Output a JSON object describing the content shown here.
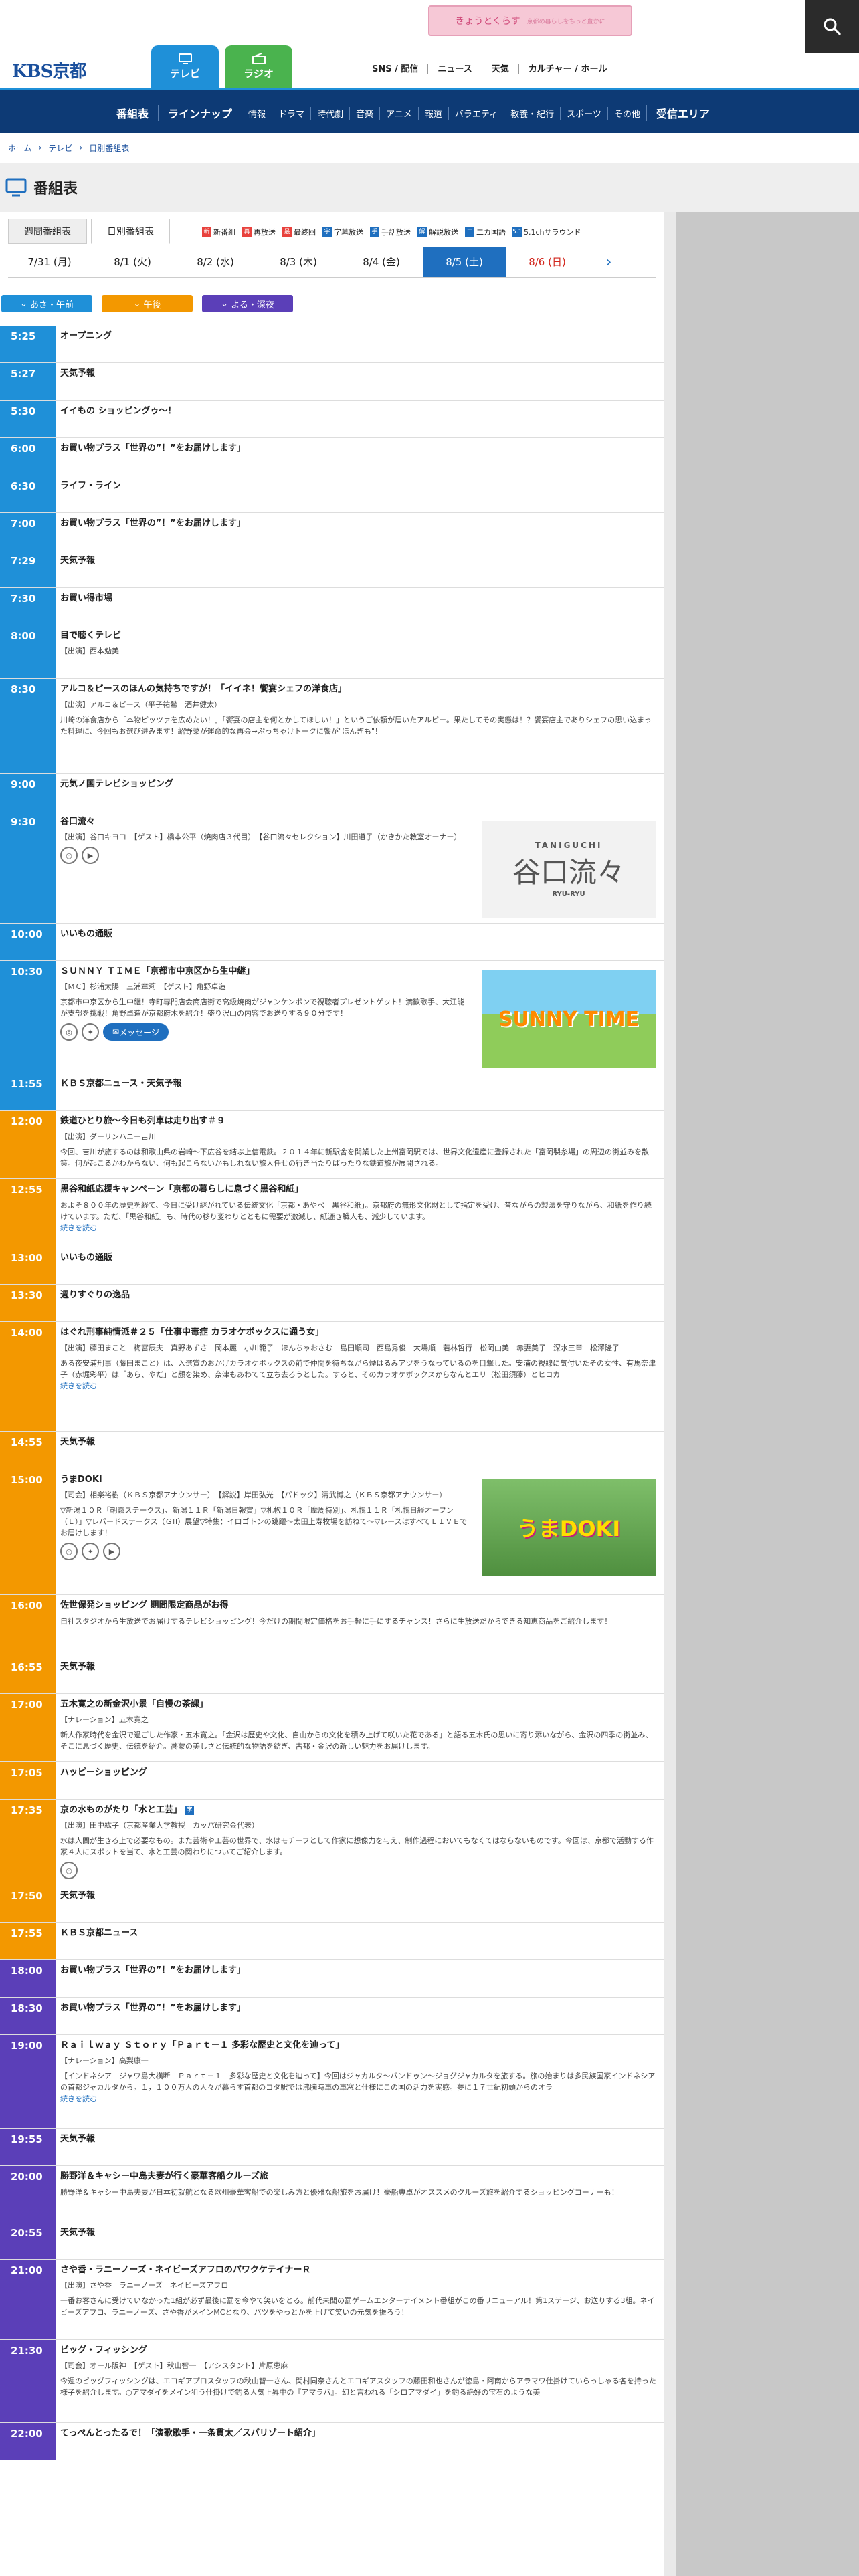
{
  "banner": {
    "text": "きょうとくらす",
    "sub": "京都の暮らしをもっと豊かに"
  },
  "logo": "KBS京都",
  "tabs": {
    "tv": "テレビ",
    "radio": "ラジオ"
  },
  "topnav": [
    "SNS / 配信",
    "ニュース",
    "天気",
    "カルチャー / ホール"
  ],
  "catbar": {
    "left": [
      "番組表",
      "ラインナップ"
    ],
    "items": [
      "情報",
      "ドラマ",
      "時代劇",
      "音楽",
      "アニメ",
      "報道",
      "バラエティ",
      "教養・紀行",
      "スポーツ",
      "その他"
    ],
    "right": "受信エリア"
  },
  "breadcrumb": [
    "ホーム",
    "テレビ",
    "日別番組表"
  ],
  "page_title": "番組表",
  "subtabs": [
    "週間番組表",
    "日別番組表"
  ],
  "legend": [
    {
      "mark": "新",
      "label": "新番組",
      "color": "#e8423d"
    },
    {
      "mark": "再",
      "label": "再放送",
      "color": "#e8423d"
    },
    {
      "mark": "最",
      "label": "最終回",
      "color": "#e8423d"
    },
    {
      "mark": "字",
      "label": "字幕放送",
      "color": "#1f6fbf"
    },
    {
      "mark": "手",
      "label": "手話放送",
      "color": "#1f6fbf"
    },
    {
      "mark": "解",
      "label": "解説放送",
      "color": "#1f6fbf"
    },
    {
      "mark": "二",
      "label": "二カ国語",
      "color": "#1f6fbf"
    },
    {
      "mark": "5.1",
      "label": "5.1chサラウンド",
      "color": "#1f6fbf"
    }
  ],
  "dates": [
    "7/31 (月)",
    "8/1 (火)",
    "8/2 (水)",
    "8/3 (木)",
    "8/4 (金)",
    "8/5 (土)",
    "8/6 (日)"
  ],
  "periods": [
    "あさ・午前",
    "午後",
    "よる・深夜"
  ],
  "more": "続きを読む",
  "message_btn": "メッセージ",
  "colors": {
    "morning": "#1f90d8",
    "afternoon": "#f39800",
    "night": "#5b3fb8"
  },
  "programs": [
    {
      "time": "5:25",
      "title": "オープニング",
      "band": "morning",
      "h": 56
    },
    {
      "time": "5:27",
      "title": "天気予報",
      "band": "morning",
      "h": 56
    },
    {
      "time": "5:30",
      "title": "イイもの ショッピングゥ〜！",
      "band": "morning",
      "h": 56
    },
    {
      "time": "6:00",
      "title": "お買い物プラス「世界の”！”をお届けします」",
      "band": "morning",
      "h": 56
    },
    {
      "time": "6:30",
      "title": "ライフ・ライン",
      "band": "morning",
      "h": 56
    },
    {
      "time": "7:00",
      "title": "お買い物プラス「世界の”！”をお届けします」",
      "band": "morning",
      "h": 56
    },
    {
      "time": "7:29",
      "title": "天気予報",
      "band": "morning",
      "h": 56
    },
    {
      "time": "7:30",
      "title": "お買い得市場",
      "band": "morning",
      "h": 56
    },
    {
      "time": "8:00",
      "title": "目で聴くテレビ",
      "band": "morning",
      "h": 80,
      "cast": "【出演】西本勉美"
    },
    {
      "time": "8:30",
      "title": "アルコ＆ピースのほんの気持ちですが！「イイネ！饗宴シェフの洋食店」",
      "band": "morning",
      "h": 142,
      "cast": "【出演】アルコ＆ピース（平子祐希　酒井健太）",
      "desc": "川崎の洋食店から「本物ピッツァを広めたい！」「饗宴の店主を何とかしてほしい！」というご依頼が届いたアルピー。果たしてその実態は！？饗宴店主でありシェフの思い込まった料理に、今回もお選び进みます！紹野菜が運命的な再会→ぷっちゃけトークに饗が\"ほんぎも\"！"
    },
    {
      "time": "9:00",
      "title": "元気ノ国テレビショッピング",
      "band": "morning",
      "h": 56
    },
    {
      "time": "9:30",
      "title": "谷口流々",
      "band": "morning",
      "h": 168,
      "cast": "【出演】谷口キヨコ　【ゲスト】橋本公平（焼肉店３代目）　【谷口流々セレクション】川田道子（かきかた教室オーナー）",
      "thumb": "谷口流々",
      "thumb_sub": "TANIGUCHI",
      "thumb_sub2": "RYU-RYU",
      "icons": [
        "web",
        "youtube"
      ]
    },
    {
      "time": "10:00",
      "title": "いいもの通販",
      "band": "morning",
      "h": 56
    },
    {
      "time": "10:30",
      "title": "ＳＵＮＮＹ ＴＩＭＥ「京都市中京区から生中継」",
      "band": "morning",
      "h": 168,
      "cast": "【ＭＣ】杉浦太陽　三浦章莉　【ゲスト】角野卓造",
      "desc": "京都市中京区から生中継！寺町専門店会商店街で高級焼肉がジャンケンポンで視聴者プレゼントゲット！満歓歌手、大江能が支部を挑戦！角野卓造が京都府木を紹介！盛り沢山の内容でお送りする９０分です！",
      "thumb": "SUNNY TIME",
      "icons": [
        "web",
        "twitter"
      ],
      "message": true
    },
    {
      "time": "11:55",
      "title": "ＫＢＳ京都ニュース・天気予報",
      "band": "morning",
      "h": 56
    },
    {
      "time": "12:00",
      "title": "鉄道ひとり旅〜今日も列車は走り出す＃９",
      "band": "afternoon",
      "h": 102,
      "cast": "【出演】ダーリンハニー吉川",
      "desc": "今回、吉川が旅するのは和歌山県の岩崎〜下広谷を結ぶ上信電鉄。２０１４年に新駅舎を開業した上州富岡駅では、世界文化遺産に登録された「富岡製糸場」の周辺の街並みを散策。何が起こるかわからない、何も起こらないかもしれない旅人任せの行き当たりばったりな鉄道旅が展開される。"
    },
    {
      "time": "12:55",
      "title": "黒谷和紙応援キャンペーン「京都の暮らしに息づく黒谷和紙」",
      "band": "afternoon",
      "h": 102,
      "desc": "およそ８００年の歴史を経て、今日に受け継がれている伝統文化「京都・あやべ　黒谷和紙」。京都府の無形文化財として指定を受け、昔ながらの製法を守りながら、和紙を作り続けています。ただ、「黒谷和紙」も、時代の移り変わりとともに需要が激減し、紙漉き職人も、減少しています。",
      "more": true
    },
    {
      "time": "13:00",
      "title": "いいもの通販",
      "band": "afternoon",
      "h": 56
    },
    {
      "time": "13:30",
      "title": "週りすぐりの逸品",
      "band": "afternoon",
      "h": 56
    },
    {
      "time": "14:00",
      "title": "はぐれ刑事純情派＃２５「仕事中毒症 カラオケボックスに通う女」",
      "band": "afternoon",
      "h": 164,
      "cast": "【出演】藤田まこと　梅宮辰夫　真野あずさ　岡本麗　小川範子　ほんちゃおさむ　島田順司　西島秀俊　大場順　若林哲行　松岡由美　赤妻美子　深水三章　松澤隆子",
      "desc": "ある夜安浦刑事（藤田まこと）は、入選賞のおかげカラオケボックスの前で仲間を待ちながら煙はるみアツをうなっているのを目撃した。安浦の視線に気付いたその女性、有馬奈津子（赤堀彩平）は「あら、やだ」と顔を染め、奈津もあわてて立ち去ろうとした。すると、そのカラオケボックスからなんとエリ（松田須藤）とヒコカ",
      "more": true
    },
    {
      "time": "14:55",
      "title": "天気予報",
      "band": "afternoon",
      "h": 56
    },
    {
      "time": "15:00",
      "title": "うまDOKI",
      "band": "afternoon",
      "h": 188,
      "cast": "【司会】相楽裕樹（ＫＢＳ京都アナウンサー）　【解説】岸田弘光　【パドック】清武博之（ＫＢＳ京都アナウンサー）",
      "desc": "▽新潟１０Ｒ「朝霧ステークス」、新潟１１Ｒ「新潟日報賞」▽札幌１０Ｒ「摩周特別」、札幌１１Ｒ「札幌日経オープン（Ｌ）」▽レパードステークス（ＧⅢ）展望▽特集：イロゴトンの跳躍〜太田上寿牧場を訪ねて〜▽レースはすべてＬＩＶＥでお届けします！",
      "thumb": "うまDOKI",
      "icons": [
        "web",
        "twitter",
        "youtube"
      ]
    },
    {
      "time": "16:00",
      "title": "佐世保発ショッピング 期間限定商品がお得",
      "band": "afternoon",
      "h": 92,
      "desc": "自社スタジオから生放送でお届けするテレビショッピング！今だけの期間限定価格をお手軽に手にするチャンス！さらに生放送だからできる知恵商品をご紹介します！"
    },
    {
      "time": "16:55",
      "title": "天気予報",
      "band": "afternoon",
      "h": 56
    },
    {
      "time": "17:00",
      "title": "五木寛之の新金沢小景「自慢の茶課」",
      "band": "afternoon",
      "h": 102,
      "cast": "【ナレーション】五木寛之",
      "desc": "新人作家時代を金沢で過ごした作家・五木寛之。「金沢は歴史や文化、自山からの文化を積み上げて咲いた花である」と語る五木氏の思いに寄り添いながら、金沢の四季の街並み、そこに息づく歴史、伝統を紹介。蕎蒙の美しさと伝統的な物語を紡ぎ、古都・金沢の新しい魅力をお届けします。"
    },
    {
      "time": "17:05",
      "title": "ハッピーショッピング",
      "band": "afternoon",
      "h": 56
    },
    {
      "time": "17:35",
      "title": "京の水ものがたり「水と工芸」",
      "band": "afternoon",
      "h": 128,
      "newtag": "字",
      "cast": "【出演】田中紘子（京都産業大学教授　カッパ研究会代表）",
      "desc": "水は人間が生きる上で必要なもの。また芸術や工芸の世界で、水はモチーフとして作家に想像力を与え、制作過程においてもなくてはならないものです。今回は、京都で活動する作家４人にスポットを当て、水と工芸の関わりについてご紹介します。",
      "icons": [
        "web"
      ]
    },
    {
      "time": "17:50",
      "title": "天気予報",
      "band": "afternoon",
      "h": 56
    },
    {
      "time": "17:55",
      "title": "ＫＢＳ京都ニュース",
      "band": "afternoon",
      "h": 56
    },
    {
      "time": "18:00",
      "title": "お買い物プラス「世界の”！”をお届けします」",
      "band": "night",
      "h": 56
    },
    {
      "time": "18:30",
      "title": "お買い物プラス「世界の”！”をお届けします」",
      "band": "night",
      "h": 56
    },
    {
      "time": "19:00",
      "title": "Ｒａｉｌｗａｙ Ｓｔｏｒｙ「Ｐａｒｔ－１ 多彩な歴史と文化を辿って」",
      "band": "night",
      "h": 140,
      "cast": "【ナレーション】高梨康一",
      "desc": "【インドネシア　ジャワ島大横断　Ｐａｒｔ－１　多彩な歴史と文化を辿って】今回はジャカルタ〜バンドゥン〜ジョグジャカルタを旅する。旅の始まりは多民族国家インドネシアの首都ジャカルタから。１，１００万人の人々が暮らす首都のコタ駅では沸騰時車の車窓と仕様にこの国の活力を実感。夢に１７世紀初頭からのオラ",
      "more": true
    },
    {
      "time": "19:55",
      "title": "天気予報",
      "band": "night",
      "h": 56
    },
    {
      "time": "20:00",
      "title": "勝野洋＆キャシー中島夫妻が行く豪華客船クルーズ旅",
      "band": "night",
      "h": 84,
      "desc": "勝野洋＆キャシー中島夫妻が日本初就航となる欧州豪華客船での楽しみ方と優雅な船旅をお届け！豪船専卓がオススメのクルーズ旅を紹介するショッピングコーナーも！"
    },
    {
      "time": "20:55",
      "title": "天気予報",
      "band": "night",
      "h": 56
    },
    {
      "time": "21:00",
      "title": "さや香・ラニーノーズ・ネイビーズアフロのパワクケテイナーＲ",
      "band": "night",
      "h": 120,
      "cast": "【出演】さや香　ラニーノーズ　ネイビーズアフロ",
      "desc": "一番お客さんに受けていなかった1組が必ず最後に罰を今やて笑いをとる。前代未聞の罰ゲームエンターテイメント番組がこの番リニューアル！第1ステージ、お送りする3組。ネイビーズアフロ、ラニーノーズ、さや香がメインMCとなり、バツをやっとかを上げて笑いの元気を振ろう！"
    },
    {
      "time": "21:30",
      "title": "ビッグ・フィッシング",
      "band": "night",
      "h": 124,
      "cast": "【司会】オール阪神　【ゲスト】秋山智一　【アシスタント】片原恵麻",
      "desc": "今週のビッグフィッシングは、エコギアプロスタッフの秋山智一さん、関村同奈さんとエコギアスタッフの藤田和也さんが徳島・阿南からアラマワ仕掛けていらっしゃる各を持った様子を紹介します。○アマダイをメイン狙う仕掛けで釣る人気上昇中の『アマラバ』。幻と言われる「シロアマダイ」を釣る絶好の宝石のような美"
    },
    {
      "time": "22:00",
      "title": "てっぺんとったるで！「演歌歌手・一条貫太／スパリゾート紹介」",
      "band": "night",
      "h": 56
    }
  ]
}
